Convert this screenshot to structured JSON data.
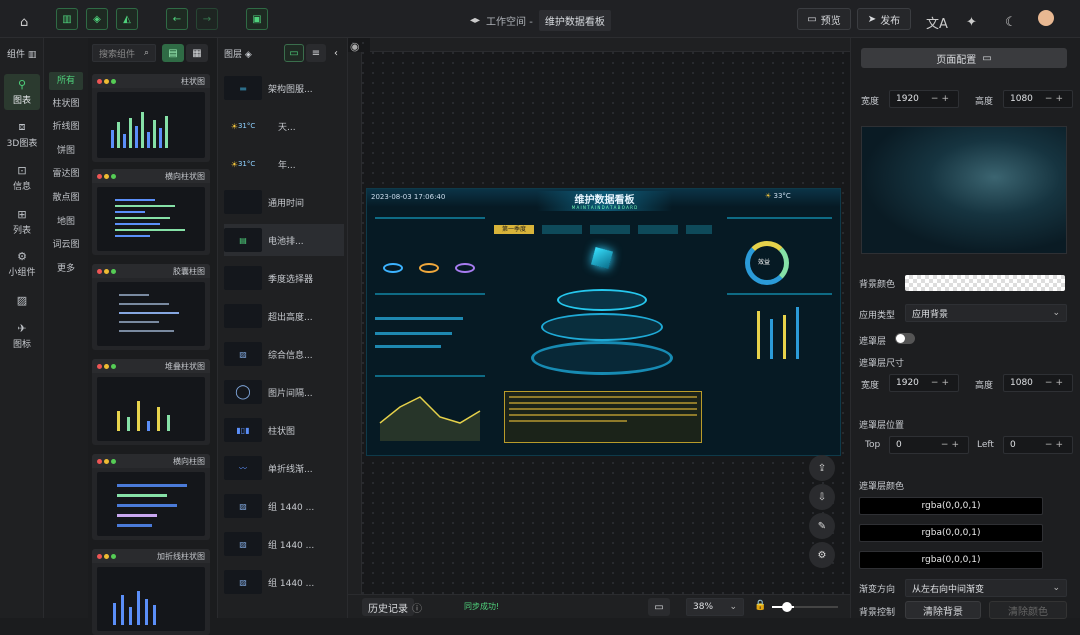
{
  "toolbar": {
    "workspace": "工作空间 -",
    "title": "维护数据看板",
    "preview": "预览",
    "publish": "发布",
    "history": "历史记录",
    "status": "同步成功!",
    "zoom": "38%"
  },
  "rail": [
    {
      "label": "图表",
      "icon": "chart-icon"
    },
    {
      "label": "3D图表",
      "icon": "cube-icon"
    },
    {
      "label": "信息",
      "icon": "info-icon"
    },
    {
      "label": "列表",
      "icon": "table-icon"
    },
    {
      "label": "小组件",
      "icon": "widget-icon"
    },
    {
      "label": "",
      "icon": "image-icon"
    },
    {
      "label": "图标",
      "icon": "plane-icon"
    }
  ],
  "components_label": "组件",
  "search_placeholder": "搜索组件",
  "subcats": [
    "所有",
    "柱状图",
    "折线图",
    "饼图",
    "雷达图",
    "散点图",
    "地图",
    "词云图",
    "更多"
  ],
  "cards": [
    {
      "title": "柱状图"
    },
    {
      "title": "横向柱状图"
    },
    {
      "title": "胶囊柱图"
    },
    {
      "title": "堆叠柱状图"
    },
    {
      "title": "横向柱图"
    },
    {
      "title": "加折线柱状图"
    }
  ],
  "layers_label": "图层",
  "layers": [
    {
      "name": "架构图服..."
    },
    {
      "name": "天...",
      "temp": "31°C"
    },
    {
      "name": "年...",
      "temp": "31°C"
    },
    {
      "name": "通用时间"
    },
    {
      "name": "电池排..."
    },
    {
      "name": "季度选择器"
    },
    {
      "name": "超出高度..."
    },
    {
      "name": "综合信息..."
    },
    {
      "name": "图片间隔..."
    },
    {
      "name": "柱状图"
    },
    {
      "name": "单折线渐..."
    },
    {
      "name": "组 1440 ..."
    },
    {
      "name": "组 1440 ..."
    },
    {
      "name": "组 1440 ..."
    }
  ],
  "dashboard": {
    "datetime": "2023-08-03 17:06:40",
    "title": "维护数据看板",
    "subtitle": "M A I N T A I N   D A T A   B O A R D",
    "temp": "33°C",
    "tab1": "第一季度",
    "ring": "效益"
  },
  "props": {
    "page_config": "页面配置",
    "width_label": "宽度",
    "width": "1920",
    "height_label": "高度",
    "height": "1080",
    "bg_color": "背景颜色",
    "apply_type": "应用类型",
    "apply_value": "应用背景",
    "mask": "遮罩层",
    "mask_size": "遮罩层尺寸",
    "mask_w": "1920",
    "mask_h": "1080",
    "mask_pos": "遮罩层位置",
    "top": "Top",
    "top_v": "0",
    "left": "Left",
    "left_v": "0",
    "mask_color": "遮罩层颜色",
    "rgba": [
      "rgba(0,0,0,1)",
      "rgba(0,0,0,1)",
      "rgba(0,0,0,1)"
    ],
    "gradient": "渐变方向",
    "gradient_v": "从左右向中间渐变",
    "bg_ctrl": "背景控制",
    "clear_bg": "清除背景",
    "clear_color": "清除颜色"
  }
}
